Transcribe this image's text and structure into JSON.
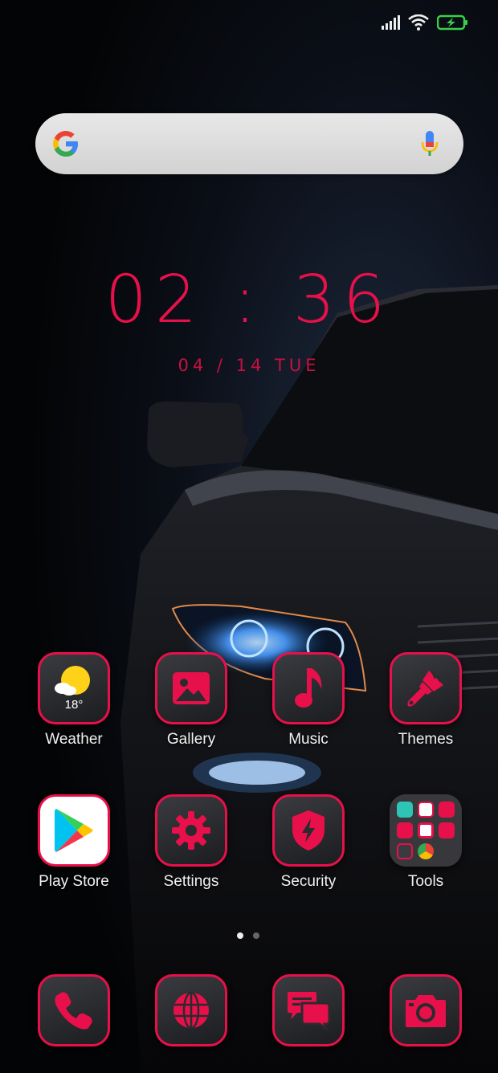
{
  "status_bar": {
    "signal": "signal-icon",
    "wifi": "wifi-icon",
    "battery": "battery-charging-icon"
  },
  "search": {
    "logo": "google-logo",
    "mic": "mic-icon"
  },
  "clock": {
    "time": "02 : 36",
    "date": "04 / 14  TUE"
  },
  "weather_widget": {
    "temperature": "18°"
  },
  "apps_row1": [
    {
      "label": "Weather",
      "icon": "weather-icon"
    },
    {
      "label": "Gallery",
      "icon": "gallery-icon"
    },
    {
      "label": "Music",
      "icon": "music-note-icon"
    },
    {
      "label": "Themes",
      "icon": "paintbrush-icon"
    }
  ],
  "apps_row2": [
    {
      "label": "Play Store",
      "icon": "play-store-icon"
    },
    {
      "label": "Settings",
      "icon": "gear-icon"
    },
    {
      "label": "Security",
      "icon": "shield-icon"
    },
    {
      "label": "Tools",
      "icon": "folder-icon"
    }
  ],
  "dock": [
    {
      "icon": "phone-icon"
    },
    {
      "icon": "globe-icon"
    },
    {
      "icon": "messages-icon"
    },
    {
      "icon": "camera-icon"
    }
  ],
  "colors": {
    "accent": "#e8104a",
    "tile": "#2a2b2f",
    "background": "#050608"
  }
}
